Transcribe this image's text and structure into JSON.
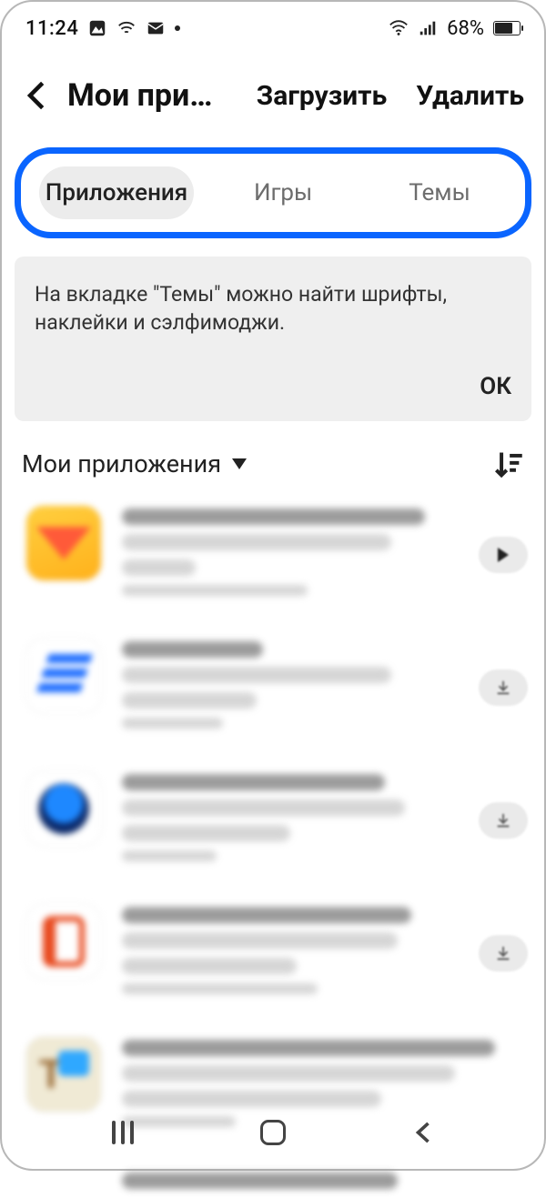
{
  "statusbar": {
    "time": "11:24",
    "battery_percent": "68%",
    "battery_fill_pct": 68
  },
  "header": {
    "title": "Мои при…",
    "actions": {
      "download": "Загрузить",
      "delete": "Удалить"
    }
  },
  "tabs": {
    "apps": "Приложения",
    "games": "Игры",
    "themes": "Темы",
    "active_index": 0
  },
  "info_card": {
    "text": "На вкладке \"Темы\" можно найти шрифты, наклейки и сэлфимоджи.",
    "ok_label": "ОК"
  },
  "section": {
    "dropdown_label": "Мои приложения"
  }
}
